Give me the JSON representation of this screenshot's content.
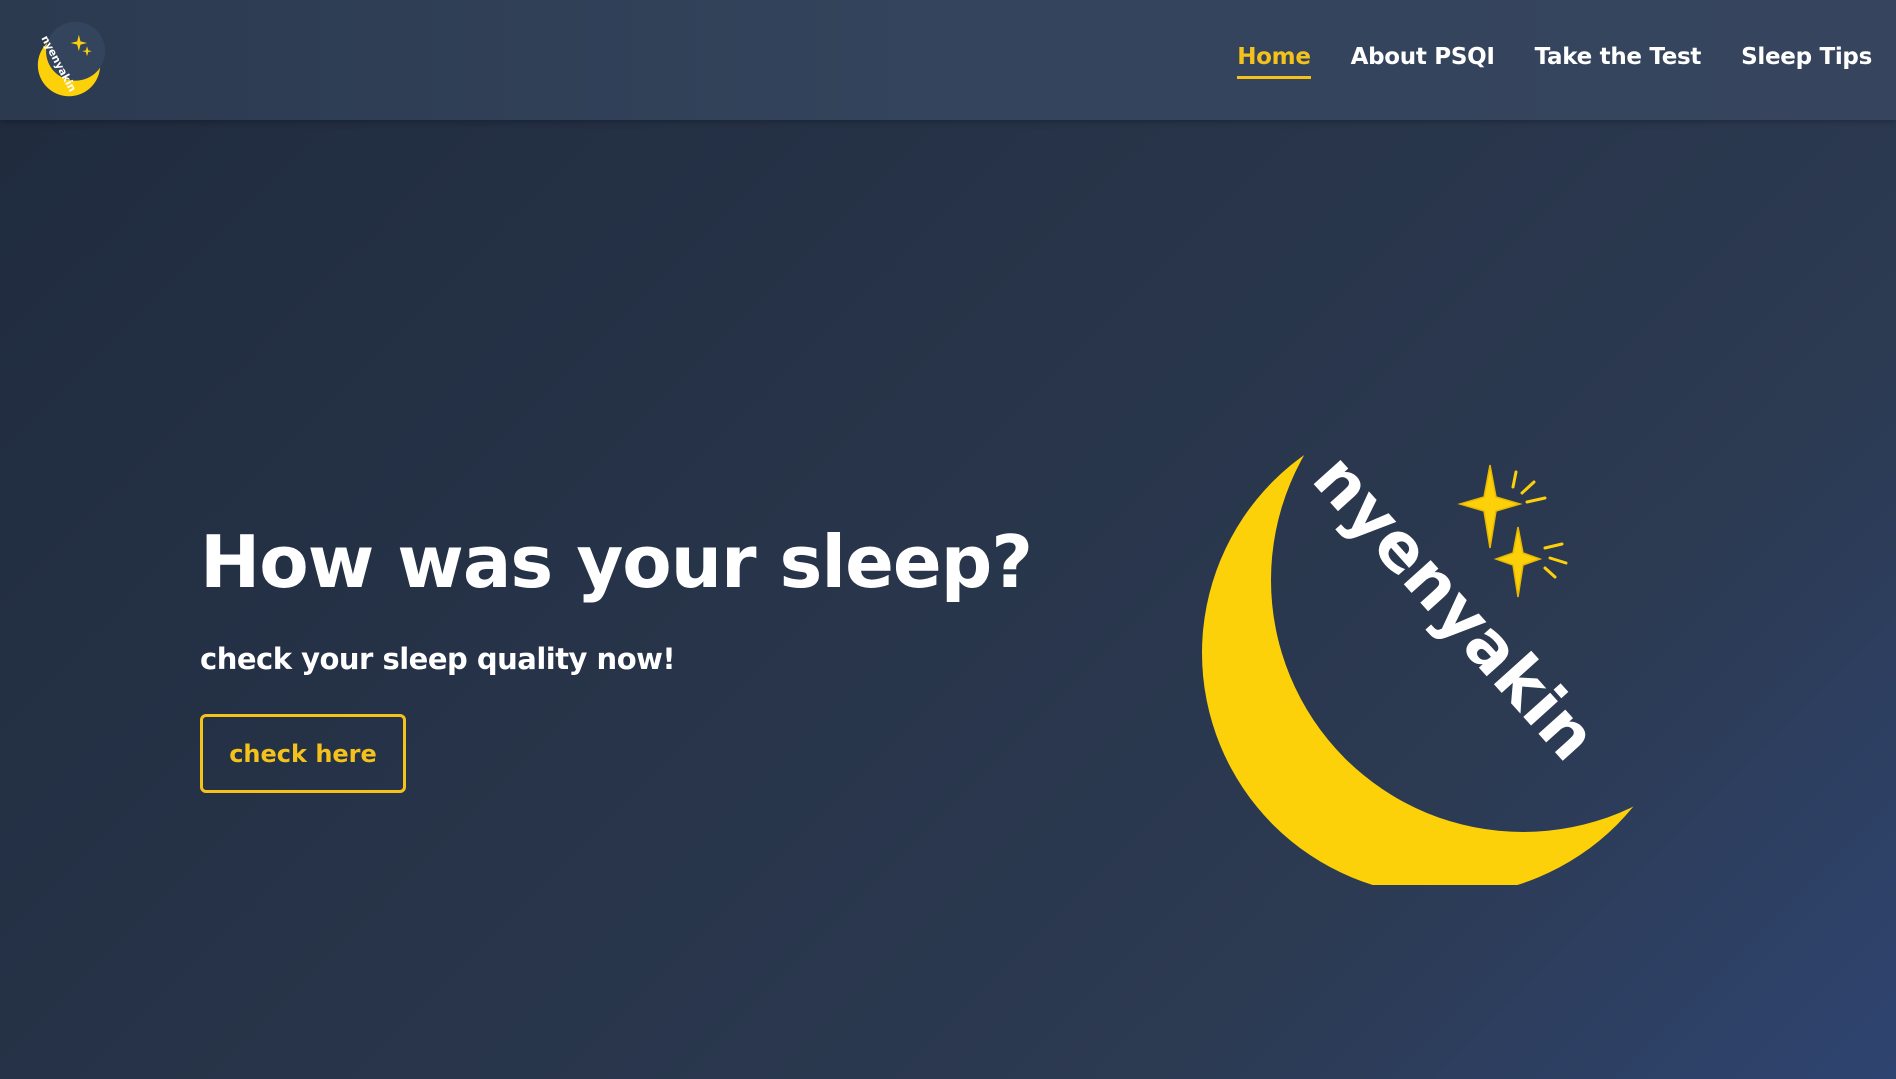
{
  "brand": {
    "name": "nyenyakin",
    "colors": {
      "accent": "#f5c21b",
      "moon": "#fdd10a",
      "background": "#273449",
      "navbar": "#33445c",
      "text": "#ffffff"
    },
    "icon": "crescent-moon-with-stars"
  },
  "nav": {
    "items": [
      {
        "label": "Home",
        "active": true
      },
      {
        "label": "About PSQI",
        "active": false
      },
      {
        "label": "Take the Test",
        "active": false
      },
      {
        "label": "Sleep Tips",
        "active": false
      }
    ]
  },
  "hero": {
    "title": "How was your sleep?",
    "subtitle": "check your sleep quality now!",
    "button_label": "check here"
  }
}
